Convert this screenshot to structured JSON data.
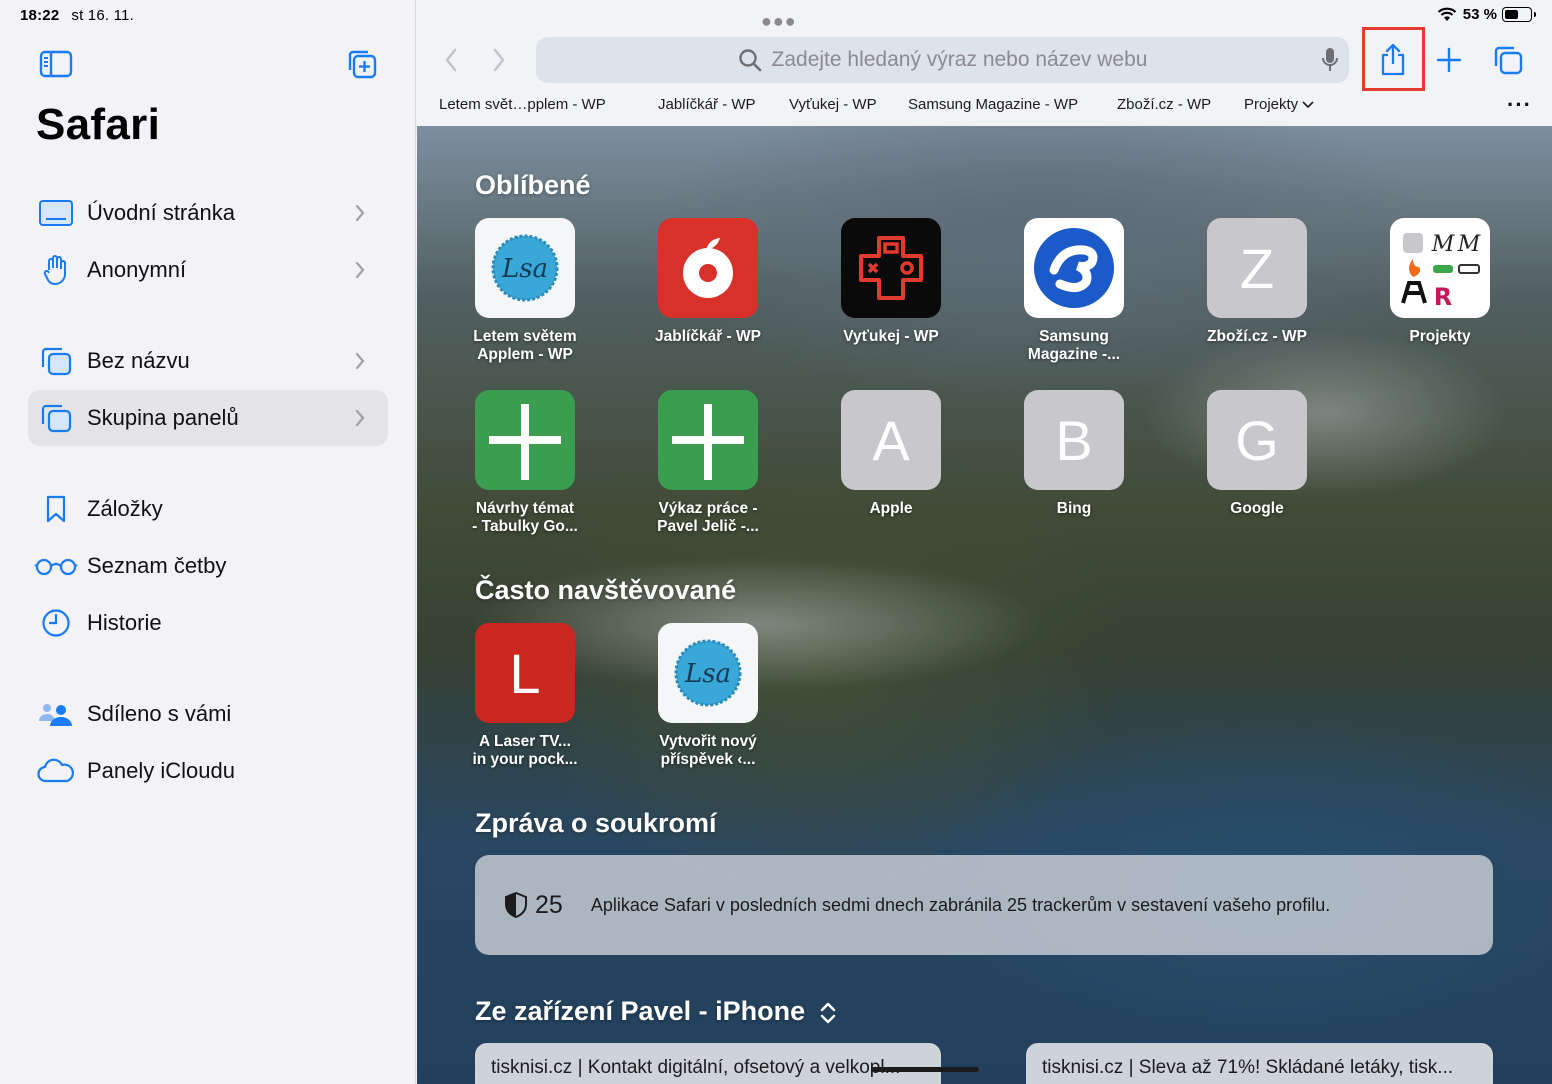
{
  "status": {
    "time": "18:22",
    "date": "st 16. 11.",
    "battery": "53 %"
  },
  "sidebar": {
    "title": "Safari",
    "items": [
      {
        "label": "Úvodní stránka",
        "icon": "start-page-icon"
      },
      {
        "label": "Anonymní",
        "icon": "hand-icon"
      },
      {
        "label": "Bez názvu",
        "icon": "tabs-icon"
      },
      {
        "label": "Skupina panelů",
        "icon": "tabs-icon",
        "selected": true
      },
      {
        "label": "Záložky",
        "icon": "bookmark-icon"
      },
      {
        "label": "Seznam četby",
        "icon": "glasses-icon"
      },
      {
        "label": "Historie",
        "icon": "clock-icon"
      },
      {
        "label": "Sdíleno s vámi",
        "icon": "shared-icon"
      },
      {
        "label": "Panely iCloudu",
        "icon": "cloud-icon"
      }
    ]
  },
  "toolbar": {
    "search_placeholder": "Zadejte hledaný výraz nebo název webu",
    "accent": "#1a7cf5",
    "highlight_color": "#e53b2c"
  },
  "bookmarks_bar": [
    "Letem svět…pplem - WP",
    "Jablíčkář - WP",
    "Vyťukej - WP",
    "Samsung Magazine - WP",
    "Zboží.cz - WP",
    "Projekty"
  ],
  "favorites": {
    "title": "Oblíbené",
    "tiles": [
      {
        "line1": "Letem světem",
        "line2": "Applem - WP"
      },
      {
        "line1": "Jablíčkář - WP",
        "line2": ""
      },
      {
        "line1": "Vyťukej - WP",
        "line2": ""
      },
      {
        "line1": "Samsung",
        "line2": "Magazine -..."
      },
      {
        "line1": "Zboží.cz - WP",
        "line2": "",
        "letter": "Z"
      },
      {
        "line1": "Projekty",
        "line2": ""
      },
      {
        "line1": "Návrhy témat",
        "line2": "- Tabulky Go..."
      },
      {
        "line1": "Výkaz práce -",
        "line2": "Pavel Jelič -..."
      },
      {
        "line1": "Apple",
        "line2": "",
        "letter": "A"
      },
      {
        "line1": "Bing",
        "line2": "",
        "letter": "B"
      },
      {
        "line1": "Google",
        "line2": "",
        "letter": "G"
      }
    ]
  },
  "frequent": {
    "title": "Často navštěvované",
    "tiles": [
      {
        "line1": "A Laser TV...",
        "line2": "in your pock...",
        "letter": "L"
      },
      {
        "line1": "Vytvořit nový",
        "line2": "příspěvek ‹..."
      }
    ]
  },
  "privacy": {
    "title": "Zpráva o soukromí",
    "count": "25",
    "text": "Aplikace Safari v posledních sedmi dnech zabránila 25 trackerům v sestavení vašeho profilu."
  },
  "device": {
    "title": "Ze zařízení Pavel - iPhone",
    "cards": [
      "tisknisi.cz | Kontakt digitální, ofsetový a velkopl...",
      "tisknisi.cz | Sleva až 71%! Skládané letáky, tisk..."
    ]
  }
}
